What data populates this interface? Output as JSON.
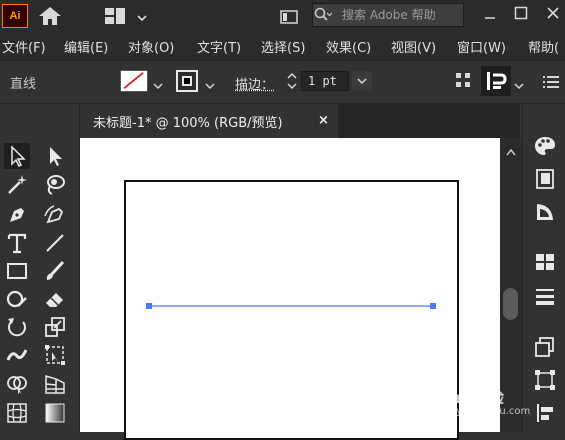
{
  "app": {
    "logo_text": "Ai",
    "search_placeholder": "搜索 Adobe 帮助"
  },
  "menu": [
    {
      "label": "文件(F)"
    },
    {
      "label": "编辑(E)"
    },
    {
      "label": "对象(O)"
    },
    {
      "label": "文字(T)"
    },
    {
      "label": "选择(S)"
    },
    {
      "label": "效果(C)"
    },
    {
      "label": "视图(V)"
    },
    {
      "label": "窗口(W)"
    },
    {
      "label": "帮助("
    }
  ],
  "control_bar": {
    "object_type": "直线",
    "stroke_label": "描边：",
    "stroke_value": "1 pt"
  },
  "document_tab": {
    "title": "未标题-1* @ 100% (RGB/预览)",
    "close_glyph": "×"
  },
  "tools": [
    {
      "name": "selection-tool-icon"
    },
    {
      "name": "direct-selection-tool-icon"
    },
    {
      "name": "magic-wand-tool-icon"
    },
    {
      "name": "lasso-tool-icon"
    },
    {
      "name": "pen-tool-icon"
    },
    {
      "name": "curvature-tool-icon"
    },
    {
      "name": "type-tool-icon"
    },
    {
      "name": "line-segment-tool-icon"
    },
    {
      "name": "rectangle-tool-icon"
    },
    {
      "name": "paintbrush-tool-icon"
    },
    {
      "name": "shaper-tool-icon"
    },
    {
      "name": "eraser-tool-icon"
    },
    {
      "name": "rotate-tool-icon"
    },
    {
      "name": "scale-tool-icon"
    },
    {
      "name": "warp-tool-icon"
    },
    {
      "name": "free-transform-tool-icon"
    },
    {
      "name": "shape-builder-tool-icon"
    },
    {
      "name": "perspective-grid-tool-icon"
    },
    {
      "name": "mesh-tool-icon"
    },
    {
      "name": "gradient-tool-icon"
    }
  ],
  "right_panel": [
    {
      "name": "color-panel-icon"
    },
    {
      "name": "libraries-panel-icon"
    },
    {
      "name": "color-guide-panel-icon"
    },
    {
      "name": "swatches-panel-icon"
    },
    {
      "name": "stroke-panel-icon"
    },
    {
      "name": "layers-panel-icon"
    },
    {
      "name": "transform-panel-icon"
    },
    {
      "name": "align-panel-icon"
    }
  ],
  "colors": {
    "accent_orange": "#ff9a00",
    "selection_blue": "#4a78ff",
    "no_fill_red": "#e02020"
  },
  "watermark": {
    "text": "Bai 经验",
    "url": "jingyan.baidu.com"
  }
}
